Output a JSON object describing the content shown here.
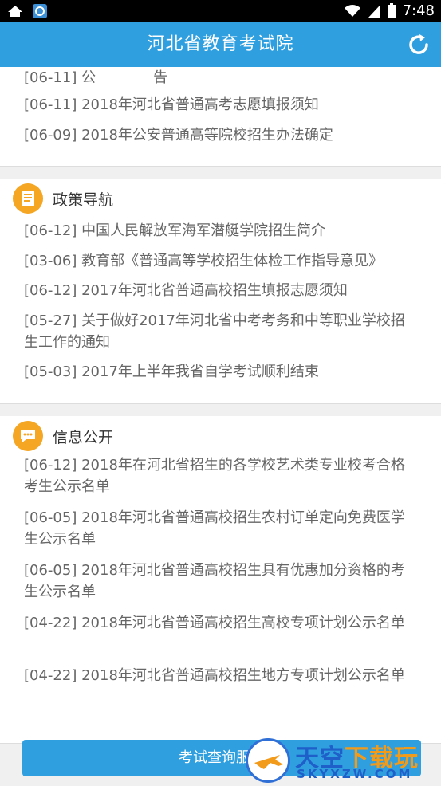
{
  "status_bar": {
    "time": "7:48"
  },
  "app": {
    "title": "河北省教育考试院"
  },
  "top_list": [
    {
      "date": "[06-11]",
      "text": "公　　　　告"
    },
    {
      "date": "[06-11]",
      "text": "2018年河北省普通高考志愿填报须知"
    },
    {
      "date": "[06-09]",
      "text": "2018年公安普通高等院校招生办法确定"
    }
  ],
  "policy": {
    "title": "政策导航",
    "items": [
      {
        "date": "[06-12]",
        "text": "中国人民解放军海军潜艇学院招生简介"
      },
      {
        "date": "[03-06]",
        "text": "教育部《普通高等学校招生体检工作指导意见》"
      },
      {
        "date": "[06-12]",
        "text": "2017年河北省普通高校招生填报志愿须知"
      },
      {
        "date": "[05-27]",
        "text": "关于做好2017年河北省中考考务和中等职业学校招生工作的通知"
      },
      {
        "date": "[05-03]",
        "text": "2017年上半年我省自学考试顺利结束"
      }
    ]
  },
  "info": {
    "title": "信息公开",
    "items": [
      {
        "date": "[06-12]",
        "text": "2018年在河北省招生的各学校艺术类专业校考合格考生公示名单"
      },
      {
        "date": "[06-05]",
        "text": "2018年河北省普通高校招生农村订单定向免费医学生公示名单"
      },
      {
        "date": "[06-05]",
        "text": "2018年河北省普通高校招生具有优惠加分资格的考生公示名单"
      },
      {
        "date": "[04-22]",
        "text": "2018年河北省普通高校招生高校专项计划公示名单"
      },
      {
        "date": "[04-22]",
        "text": "2018年河北省普通高校招生地方专项计划公示名单"
      }
    ]
  },
  "bottom": {
    "button_label": "考试查询服务"
  },
  "watermark": {
    "main": "天空",
    "accent": "下载玩",
    "sub": "SKYXZW.COM"
  }
}
